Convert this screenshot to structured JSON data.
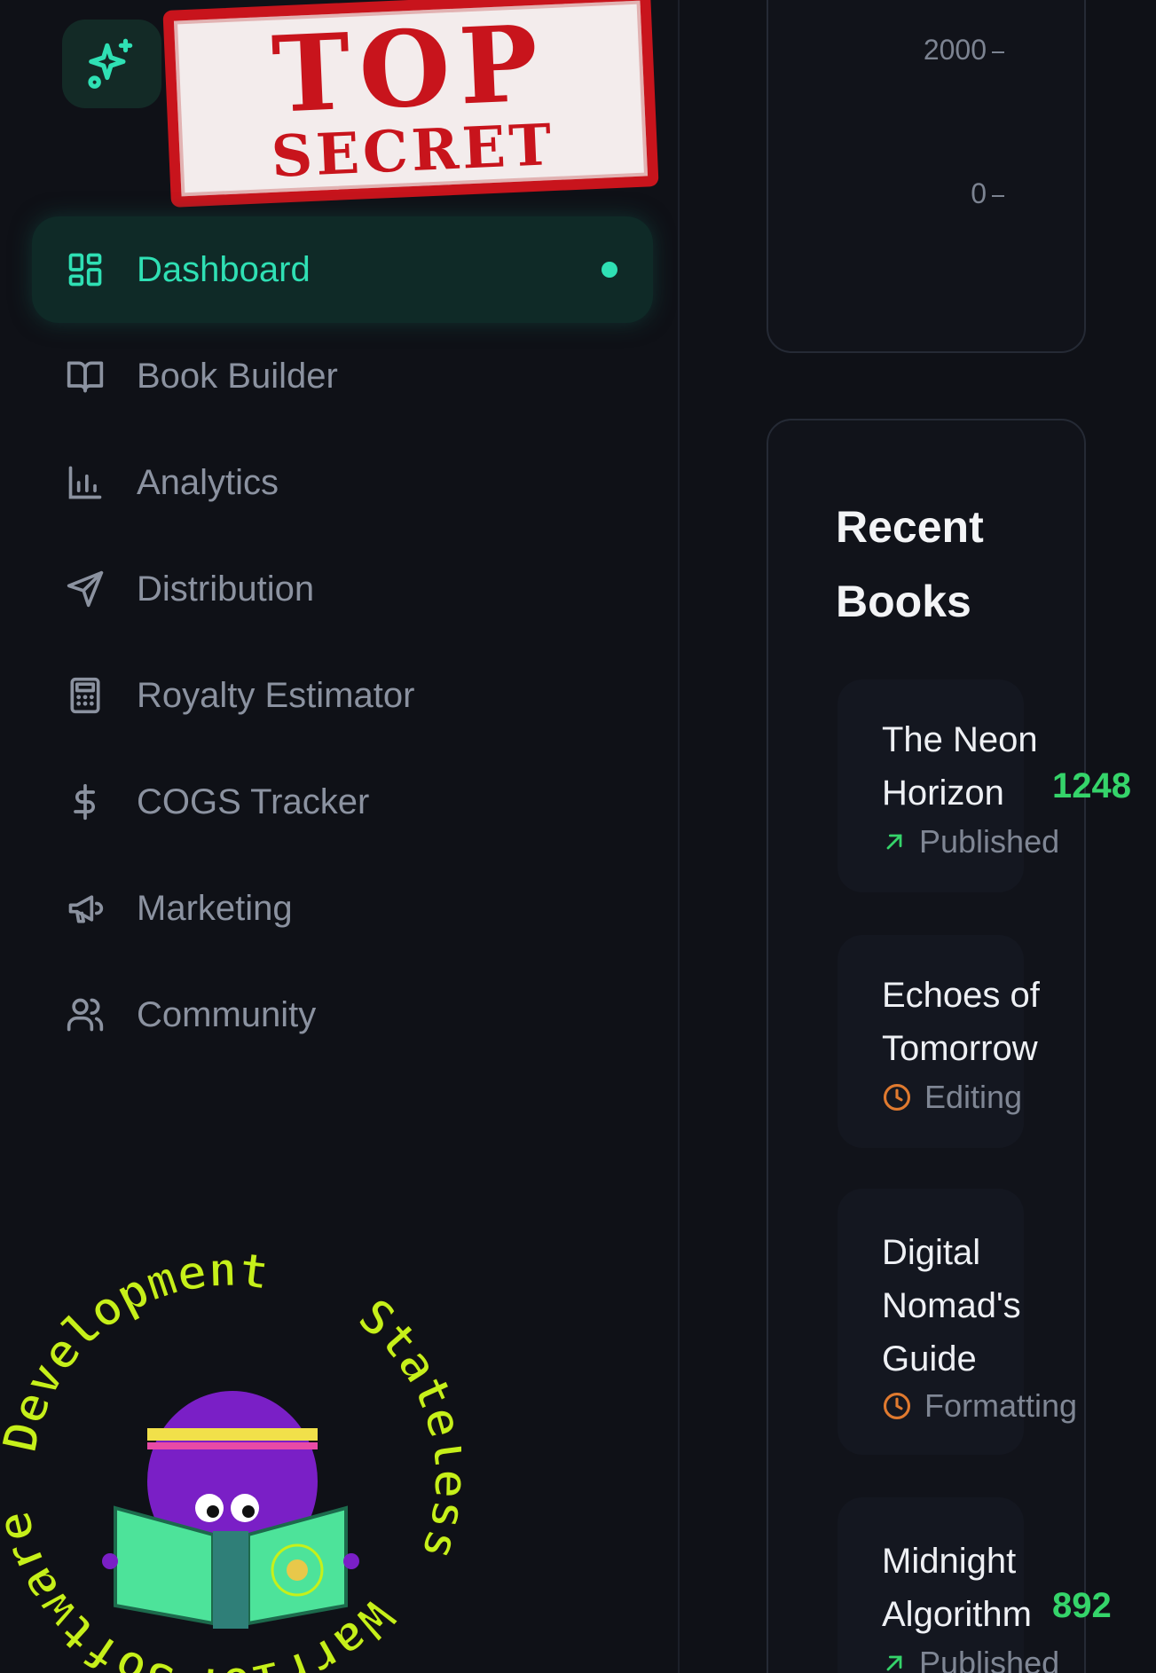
{
  "colors": {
    "background": "#0f1117",
    "accent": "#2fe0b4",
    "muted_text": "#8b92a0",
    "published_green": "#35d46a",
    "pending_orange": "#e07a2f",
    "stamp_red": "#c8141c",
    "badge_lime": "#c6f01a"
  },
  "app": {
    "logo_icon": "sparkles-icon"
  },
  "stamp": {
    "line1": "TOP",
    "line2": "SECRET"
  },
  "sidebar": {
    "items": [
      {
        "label": "Dashboard",
        "icon": "dashboard-grid-icon",
        "active": true
      },
      {
        "label": "Book Builder",
        "icon": "open-book-icon"
      },
      {
        "label": "Analytics",
        "icon": "bar-chart-icon"
      },
      {
        "label": "Distribution",
        "icon": "send-icon"
      },
      {
        "label": "Royalty Estimator",
        "icon": "calculator-icon"
      },
      {
        "label": "COGS Tracker",
        "icon": "dollar-icon"
      },
      {
        "label": "Marketing",
        "icon": "megaphone-icon"
      },
      {
        "label": "Community",
        "icon": "users-icon"
      }
    ]
  },
  "badge": {
    "ring_text_top": "Development",
    "ring_text_right": "Stateless",
    "ring_text_bottom": "Warrior",
    "ring_text_left": "Software"
  },
  "chart": {
    "y_ticks": [
      "2000",
      "0"
    ]
  },
  "recent_books": {
    "title": "Recent Books",
    "books": [
      {
        "title": "The Neon Horizon",
        "status": "Published",
        "status_icon": "trend-up-arrow-icon",
        "count": "1248"
      },
      {
        "title": "Echoes of Tomorrow",
        "status": "Editing",
        "status_icon": "clock-icon",
        "count": ""
      },
      {
        "title": "Digital Nomad's Guide",
        "status": "Formatting",
        "status_icon": "clock-icon",
        "count": ""
      },
      {
        "title": "Midnight Algorithm",
        "status": "Published",
        "status_icon": "trend-up-arrow-icon",
        "count": "892"
      }
    ]
  }
}
